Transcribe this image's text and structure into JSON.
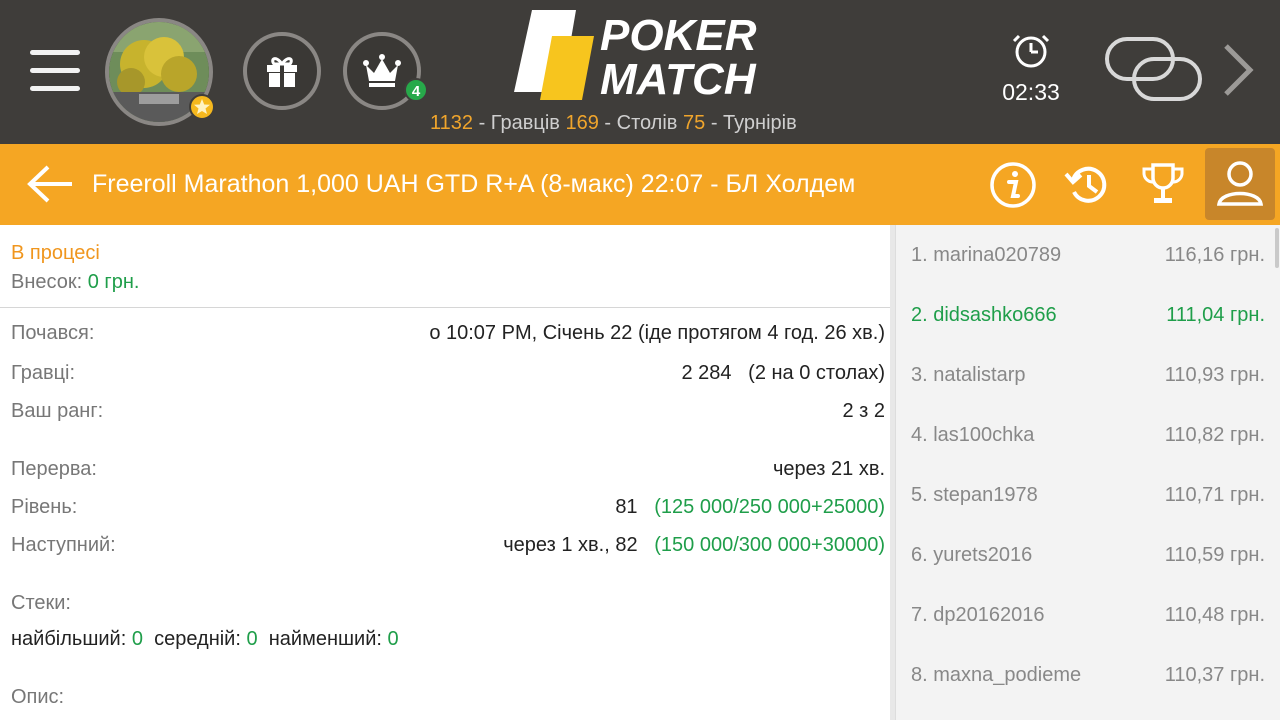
{
  "header": {
    "logo_line1": "POKER",
    "logo_line2": "MATCH",
    "notification_count": "4",
    "stats": {
      "players_count": "1132",
      "players_label": "- Гравців",
      "tables_count": "169",
      "tables_label": "- Столів",
      "tournaments_count": "75",
      "tournaments_label": "- Турнірів"
    },
    "clock_time": "02:33",
    "colors": {
      "bg": "#3f3d3a",
      "accent": "#f0a52c",
      "badge": "#27a94a"
    }
  },
  "titlebar": {
    "title": "Freeroll Marathon 1,000 UAH GTD R+A (8-макс) 22:07 - БЛ Холдем",
    "color": "#f5a623",
    "icons": [
      "back-arrow-icon",
      "info-icon",
      "history-icon",
      "trophy-icon",
      "player-icon"
    ]
  },
  "details": {
    "status": "В процесі",
    "contribution_label": "Внесок:",
    "contribution_value": "0 грн.",
    "started_label": "Почався:",
    "started_value": "о 10:07 PM, Січень 22 (іде протягом 4 год. 26 хв.)",
    "players_label": "Гравці:",
    "players_value": "2 284",
    "players_extra": "(2 на 0 столах)",
    "rank_label": "Ваш ранг:",
    "rank_value": "2 з 2",
    "break_label": "Перерва:",
    "break_value": "через 21 хв.",
    "level_label": "Рівень:",
    "level_value": "81",
    "level_blinds": "(125 000/250 000+25000)",
    "next_label": "Наступний:",
    "next_value": "через 1 хв., 82",
    "next_blinds": "(150 000/300 000+30000)",
    "stacks_label": "Стеки:",
    "stack_largest_label": "найбільший:",
    "stack_largest_value": "0",
    "stack_avg_label": "середній:",
    "stack_avg_value": "0",
    "stack_smallest_label": "найменший:",
    "stack_smallest_value": "0",
    "description_label": "Опис:"
  },
  "players": [
    {
      "name": "1. marina020789",
      "amount": "116,16 грн."
    },
    {
      "name": "2. didsashko666",
      "amount": "111,04 грн."
    },
    {
      "name": "3. natalistarp",
      "amount": "110,93 грн."
    },
    {
      "name": "4. las100chka",
      "amount": "110,82 грн."
    },
    {
      "name": "5. stepan1978",
      "amount": "110,71 грн."
    },
    {
      "name": "6. yurets2016",
      "amount": "110,59 грн."
    },
    {
      "name": "7. dp20162016",
      "amount": "110,48 грн."
    },
    {
      "name": "8. maxna_podieme",
      "amount": "110,37 грн."
    }
  ]
}
